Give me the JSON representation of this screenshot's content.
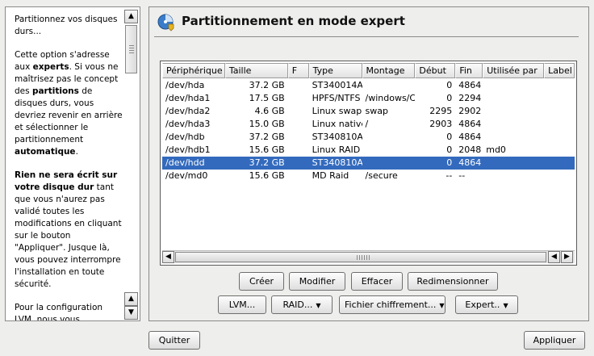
{
  "help": {
    "paragraphs": [
      [
        {
          "t": "Partitionnez vos disques durs..."
        }
      ],
      [
        {
          "t": "Cette option s'adresse aux "
        },
        {
          "t": "experts",
          "b": true
        },
        {
          "t": ". Si vous ne maîtrisez pas le concept des "
        },
        {
          "t": "partitions",
          "b": true
        },
        {
          "t": " de disques durs, vous devriez revenir en arrière et sélectionner le partitionnement "
        },
        {
          "t": "automatique",
          "b": true
        },
        {
          "t": "."
        }
      ],
      [
        {
          "t": "Rien ne sera écrit sur votre disque dur",
          "b": true
        },
        {
          "t": " tant que vous n'aurez pas validé toutes les modifications en cliquant sur le bouton \"Appliquer\". Jusque là, vous pouvez interrompre l'installation en toute sécurité."
        }
      ],
      [
        {
          "t": "Pour la configuration LVM, nous vous"
        }
      ]
    ]
  },
  "main": {
    "title": "Partitionnement en mode expert",
    "columns": [
      "Périphérique",
      "Taille",
      "F",
      "Type",
      "Montage",
      "Début",
      "Fin",
      "Utilisée par",
      "Label"
    ],
    "rows": [
      [
        "/dev/hda",
        "37.2 GB",
        "",
        "ST340014A",
        "",
        "0",
        "4864",
        "",
        ""
      ],
      [
        "/dev/hda1",
        "17.5 GB",
        "",
        "HPFS/NTFS",
        "/windows/C",
        "0",
        "2294",
        "",
        ""
      ],
      [
        "/dev/hda2",
        "4.6 GB",
        "",
        "Linux swap",
        "swap",
        "2295",
        "2902",
        "",
        ""
      ],
      [
        "/dev/hda3",
        "15.0 GB",
        "",
        "Linux native",
        "/",
        "2903",
        "4864",
        "",
        ""
      ],
      [
        "/dev/hdb",
        "37.2 GB",
        "",
        "ST340810A",
        "",
        "0",
        "4864",
        "",
        ""
      ],
      [
        "/dev/hdb1",
        "15.6 GB",
        "",
        "Linux RAID",
        "",
        "0",
        "2048",
        "md0",
        ""
      ],
      [
        "/dev/hdd",
        "37.2 GB",
        "",
        "ST340810A",
        "",
        "0",
        "4864",
        "",
        ""
      ],
      [
        "/dev/md0",
        "15.6 GB",
        "",
        "MD Raid",
        "/secure",
        "--",
        "--",
        "",
        ""
      ]
    ],
    "selected_row": 6
  },
  "buttons": {
    "create": "Créer",
    "modify": "Modifier",
    "delete": "Effacer",
    "resize": "Redimensionner",
    "lvm": "LVM...",
    "raid": "RAID...",
    "crypt": "Fichier chiffrement...",
    "expert": "Expert..",
    "quit": "Quitter",
    "apply": "Appliquer"
  },
  "icons": {
    "title": "partition-disk-icon",
    "up": "▲",
    "down": "▼",
    "left": "◀",
    "right": "▶",
    "menu": "▼"
  },
  "colors": {
    "selection": "#336abd",
    "icon_blue": "#3a7cc9",
    "icon_gold": "#e8b520"
  }
}
